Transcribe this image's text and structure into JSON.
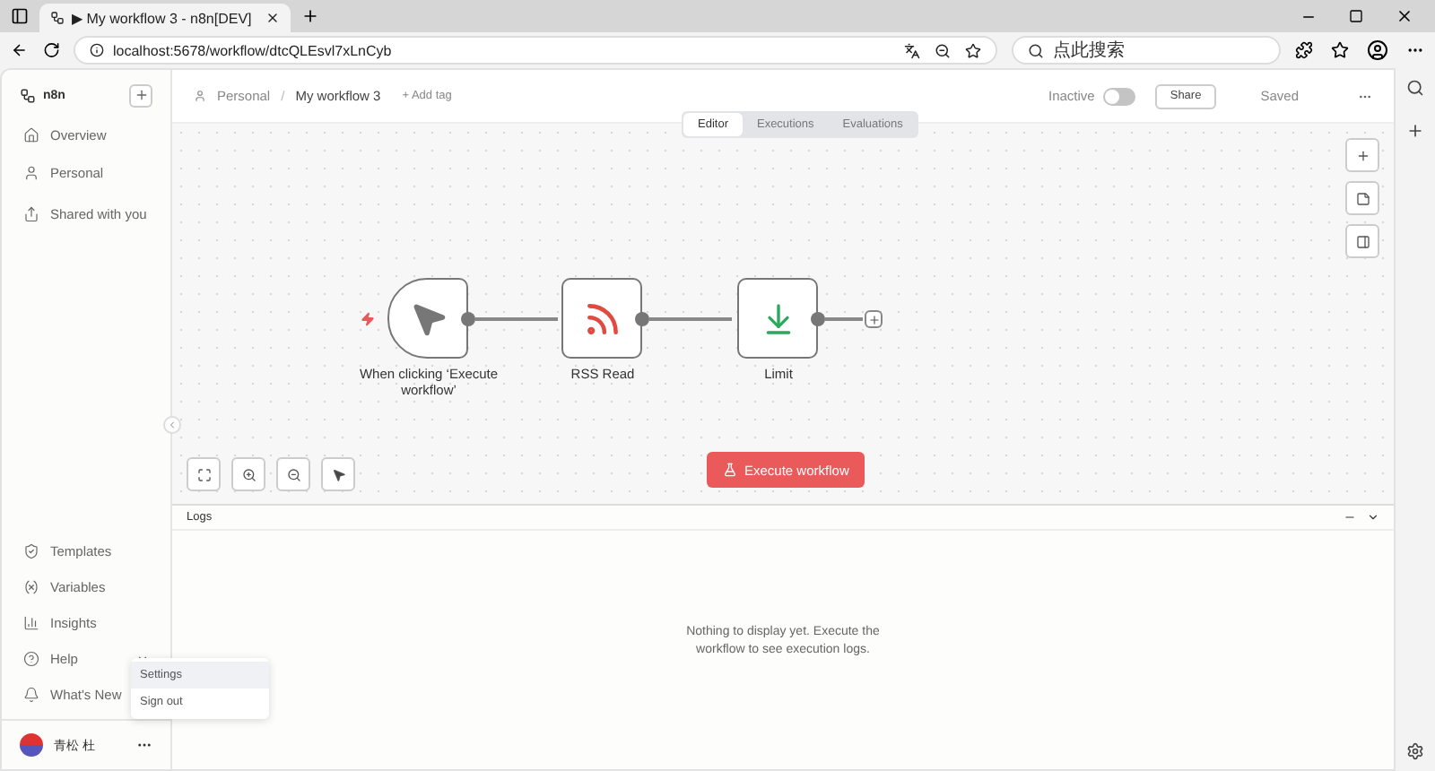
{
  "browser": {
    "tab_title": "▶ My workflow 3 - n8n[DEV]",
    "url": "localhost:5678/workflow/dtcQLEsvl7xLnCyb",
    "search_placeholder": "点此搜索"
  },
  "sidebar": {
    "brand": "n8n",
    "top_items": [
      {
        "label": "Overview",
        "kind": "home"
      },
      {
        "label": "Personal",
        "kind": "user"
      },
      {
        "label": "Shared with you",
        "kind": "share"
      }
    ],
    "bottom_items": [
      {
        "label": "Templates",
        "kind": "templates"
      },
      {
        "label": "Variables",
        "kind": "variables"
      },
      {
        "label": "Insights",
        "kind": "insights"
      },
      {
        "label": "Help",
        "kind": "help"
      },
      {
        "label": "What's New",
        "kind": "bell"
      }
    ],
    "user_name": "青松 杜"
  },
  "user_menu": [
    {
      "label": "Settings",
      "selected": true
    },
    {
      "label": "Sign out",
      "selected": false
    }
  ],
  "header": {
    "breadcrumb": [
      "Personal",
      "My workflow 3"
    ],
    "separator": "/",
    "add_tag": "+ Add tag",
    "status_label": "Inactive",
    "active": false,
    "share": "Share",
    "saved": "Saved"
  },
  "view_tabs": [
    {
      "label": "Editor",
      "selected": true
    },
    {
      "label": "Executions",
      "selected": false
    },
    {
      "label": "Evaluations",
      "selected": false
    }
  ],
  "nodes": [
    {
      "kind": "trigger",
      "label": "When clicking ‘Execute workflow’"
    },
    {
      "kind": "rss",
      "label": "RSS Read"
    },
    {
      "kind": "limit",
      "label": "Limit"
    }
  ],
  "execute_button": "Execute workflow",
  "logs": {
    "title": "Logs",
    "empty_message": "Nothing to display yet. Execute the workflow to see execution logs."
  }
}
